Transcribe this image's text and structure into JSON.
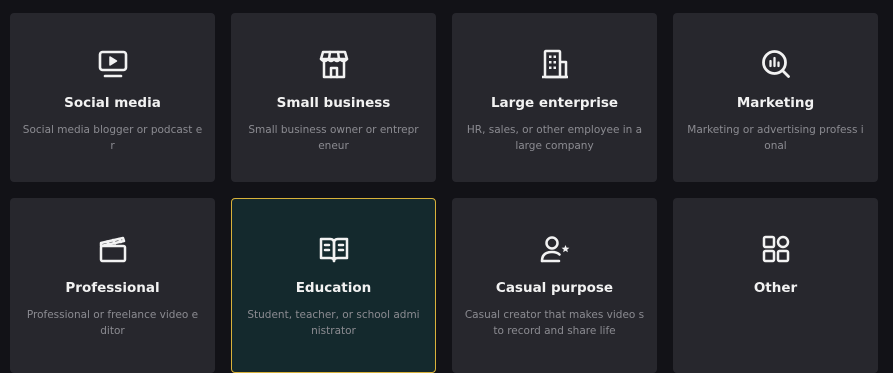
{
  "colors": {
    "background": "#121217",
    "card": "#27272d",
    "card_selected": "#14292d",
    "selected_border": "#d8b13a",
    "title": "#f2f2f2",
    "description": "#8b8b91"
  },
  "cards": [
    {
      "title": "Social media",
      "description": "Social media blogger or podcast er",
      "icon": "monitor-play-icon",
      "selected": false
    },
    {
      "title": "Small business",
      "description": "Small business owner or entrepr eneur",
      "icon": "storefront-icon",
      "selected": false
    },
    {
      "title": "Large enterprise",
      "description": "HR, sales, or other employee in a large company",
      "icon": "office-building-icon",
      "selected": false
    },
    {
      "title": "Marketing",
      "description": "Marketing or advertising profess ional",
      "icon": "analytics-search-icon",
      "selected": false
    },
    {
      "title": "Professional",
      "description": "Professional or freelance video e ditor",
      "icon": "clapperboard-icon",
      "selected": false
    },
    {
      "title": "Education",
      "description": "Student, teacher, or school admi nistrator",
      "icon": "open-book-icon",
      "selected": true
    },
    {
      "title": "Casual purpose",
      "description": "Casual creator that makes video s to record and share life",
      "icon": "user-star-icon",
      "selected": false
    },
    {
      "title": "Other",
      "description": "",
      "icon": "grid-apps-icon",
      "selected": false
    }
  ]
}
